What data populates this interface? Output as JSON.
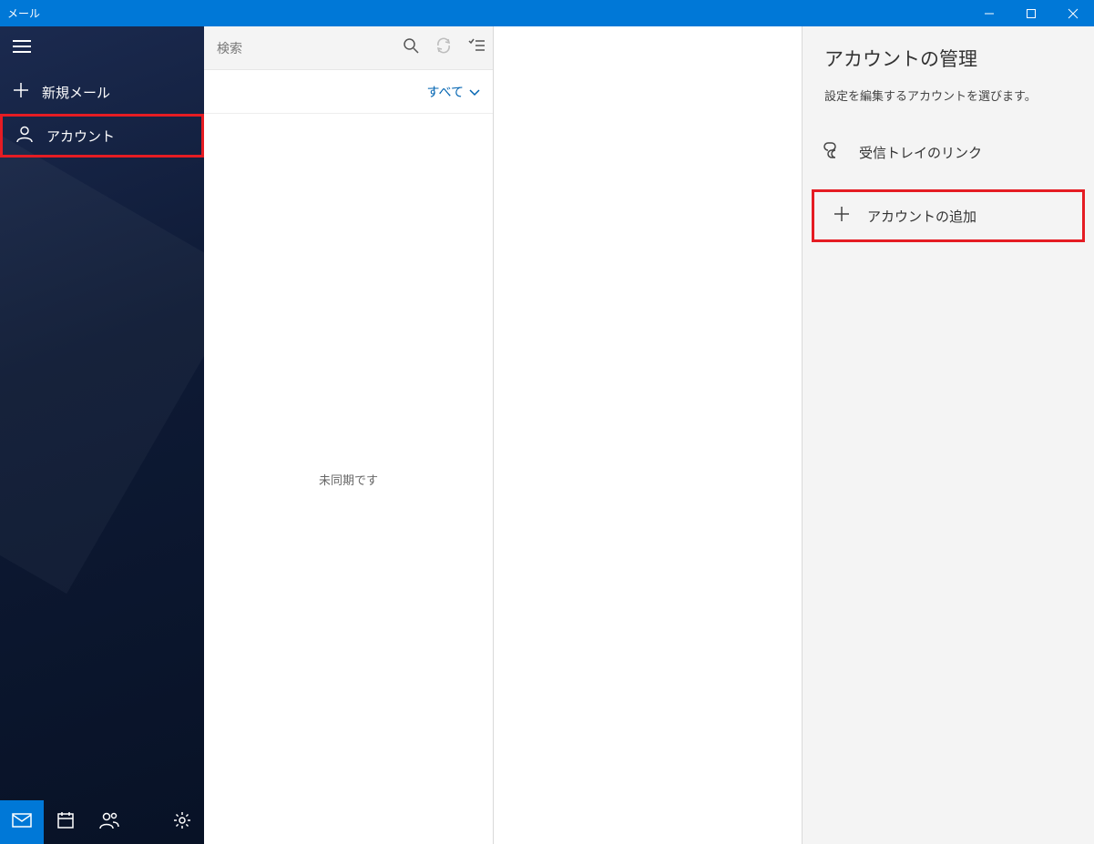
{
  "titlebar": {
    "title": "メール"
  },
  "sidebar": {
    "new_mail": "新規メール",
    "accounts": "アカウント"
  },
  "search": {
    "placeholder": "検索"
  },
  "filter": {
    "label": "すべて"
  },
  "list": {
    "empty": "未同期です"
  },
  "settings": {
    "title": "アカウントの管理",
    "subtitle": "設定を編集するアカウントを選びます。",
    "link_inbox": "受信トレイのリンク",
    "add_account": "アカウントの追加"
  }
}
